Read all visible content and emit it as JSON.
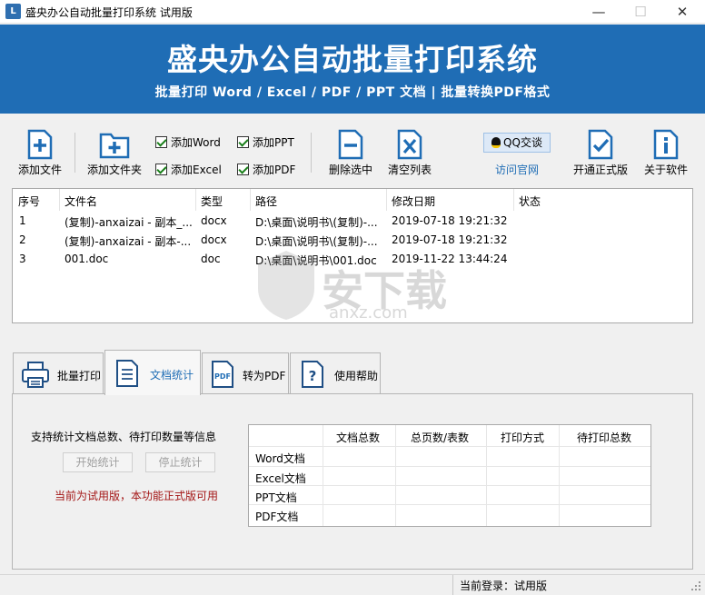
{
  "window": {
    "title": "盛央办公自动批量打印系统 试用版",
    "controls": {
      "minimize": "—",
      "maximize": "☐",
      "close": "✕"
    }
  },
  "banner": {
    "title": "盛央办公自动批量打印系统",
    "subtitle": "批量打印 Word / Excel / PDF / PPT 文档  |  批量转换PDF格式"
  },
  "toolbar": {
    "add_file": "添加文件",
    "add_folder": "添加文件夹",
    "checkboxes": [
      {
        "label": "添加Word",
        "checked": true
      },
      {
        "label": "添加Excel",
        "checked": true
      },
      {
        "label": "添加PPT",
        "checked": true
      },
      {
        "label": "添加PDF",
        "checked": true
      }
    ],
    "delete_selected": "删除选中",
    "clear_list": "清空列表",
    "qq_chat": "QQ交谈",
    "visit_site": "访问官网",
    "activate": "开通正式版",
    "about": "关于软件",
    "icon_color": "#1f6db5"
  },
  "file_list": {
    "columns": [
      "序号",
      "文件名",
      "类型",
      "路径",
      "修改日期",
      "状态"
    ],
    "rows": [
      [
        "1",
        "(复制)-anxaizai - 副本_...",
        "docx",
        "D:\\桌面\\说明书\\(复制)-...",
        "2019-07-18 19:21:32",
        ""
      ],
      [
        "2",
        "(复制)-anxaizai - 副本-...",
        "docx",
        "D:\\桌面\\说明书\\(复制)-...",
        "2019-07-18 19:21:32",
        ""
      ],
      [
        "3",
        "001.doc",
        "doc",
        "D:\\桌面\\说明书\\001.doc",
        "2019-11-22 13:44:24",
        ""
      ]
    ]
  },
  "watermark": {
    "text": "安下载",
    "sub": "anxz.com"
  },
  "tabs": [
    {
      "label": "批量打印",
      "active": false
    },
    {
      "label": "文档统计",
      "active": true
    },
    {
      "label": "转为PDF",
      "active": false
    },
    {
      "label": "使用帮助",
      "active": false
    }
  ],
  "stats_panel": {
    "description": "支持统计文档总数、待打印数量等信息",
    "start_button": "开始统计",
    "stop_button": "停止统计",
    "trial_notice": "当前为试用版，本功能正式版可用",
    "notice_color": "#a31515",
    "table": {
      "columns": [
        "",
        "文档总数",
        "总页数/表数",
        "打印方式",
        "待打印总数"
      ],
      "rows": [
        "Word文档",
        "Excel文档",
        "PPT文档",
        "PDF文档"
      ]
    }
  },
  "statusbar": {
    "login_label": "当前登录：试用版"
  }
}
